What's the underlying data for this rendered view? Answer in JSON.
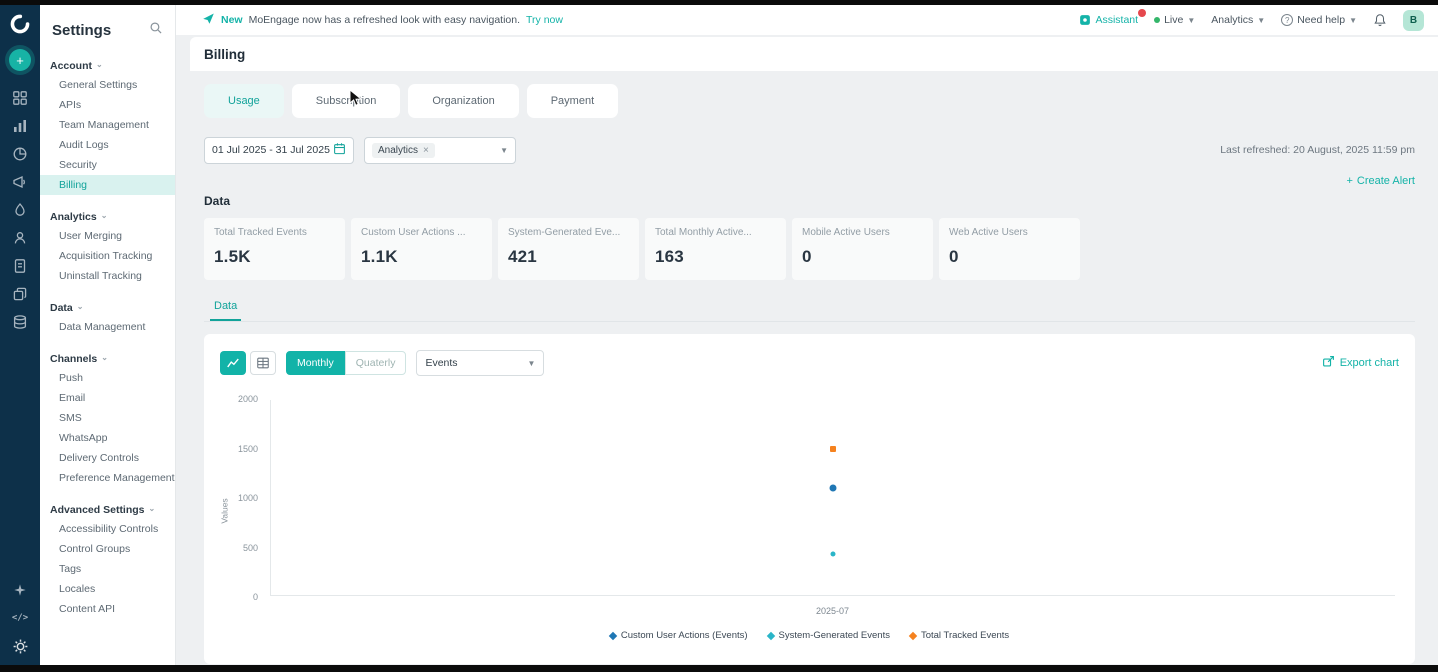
{
  "banner": {
    "badge": "New",
    "text": "MoEngage now has a refreshed look with easy navigation.",
    "cta": "Try now"
  },
  "topbar": {
    "assistant": "Assistant",
    "live": "Live",
    "analytics": "Analytics",
    "help": "Need help",
    "avatar": "B"
  },
  "sidebar": {
    "title": "Settings",
    "active_item": "Billing",
    "sections": [
      {
        "label": "Account",
        "items": [
          "General Settings",
          "APIs",
          "Team Management",
          "Audit Logs",
          "Security",
          "Billing"
        ]
      },
      {
        "label": "Analytics",
        "items": [
          "User Merging",
          "Acquisition Tracking",
          "Uninstall Tracking"
        ]
      },
      {
        "label": "Data",
        "items": [
          "Data Management"
        ]
      },
      {
        "label": "Channels",
        "items": [
          "Push",
          "Email",
          "SMS",
          "WhatsApp",
          "Delivery Controls",
          "Preference Management"
        ]
      },
      {
        "label": "Advanced Settings",
        "items": [
          "Accessibility Controls",
          "Control Groups",
          "Tags",
          "Locales",
          "Content API"
        ]
      }
    ]
  },
  "page": {
    "title": "Billing",
    "tabs": [
      "Usage",
      "Subscription",
      "Organization",
      "Payment"
    ],
    "active_tab": "Usage",
    "date_range": "01 Jul 2025 - 31 Jul 2025",
    "filter_chip": "Analytics",
    "last_refreshed": "Last refreshed: 20 August, 2025 11:59 pm",
    "create_alert": "Create Alert"
  },
  "metrics": {
    "heading": "Data",
    "cards": [
      {
        "label": "Total Tracked Events",
        "value": "1.5K"
      },
      {
        "label": "Custom User Actions ...",
        "value": "1.1K"
      },
      {
        "label": "System-Generated Eve...",
        "value": "421"
      },
      {
        "label": "Total Monthly Active...",
        "value": "163"
      },
      {
        "label": "Mobile Active Users",
        "value": "0"
      },
      {
        "label": "Web Active Users",
        "value": "0"
      }
    ]
  },
  "chart_panel": {
    "tab": "Data",
    "granularity": [
      "Monthly",
      "Quaterly"
    ],
    "active_granularity": "Monthly",
    "metric_select": "Events",
    "export": "Export chart"
  },
  "chart_data": {
    "type": "scatter",
    "x": [
      "2025-07"
    ],
    "ylabel": "Values",
    "ylim": [
      0,
      2000
    ],
    "yticks": [
      0,
      500,
      1000,
      1500,
      2000
    ],
    "legend_position": "bottom-center",
    "grid": false,
    "series": [
      {
        "name": "Custom User Actions (Events)",
        "color": "#1f77b4",
        "marker": "circle",
        "size": 7,
        "values": [
          1100
        ]
      },
      {
        "name": "System-Generated Events",
        "color": "#2ab5c8",
        "marker": "circle",
        "size": 5,
        "values": [
          421
        ]
      },
      {
        "name": "Total Tracked Events",
        "color": "#f5821f",
        "marker": "square",
        "size": 6,
        "values": [
          1500
        ]
      }
    ]
  },
  "colors": {
    "accent_teal": "#12b3a8",
    "rail_navy": "#0d3049",
    "active_item_bg": "#d9f2ef"
  },
  "icons": {
    "caret_down": "⌄",
    "close": "×",
    "plus": "+"
  }
}
